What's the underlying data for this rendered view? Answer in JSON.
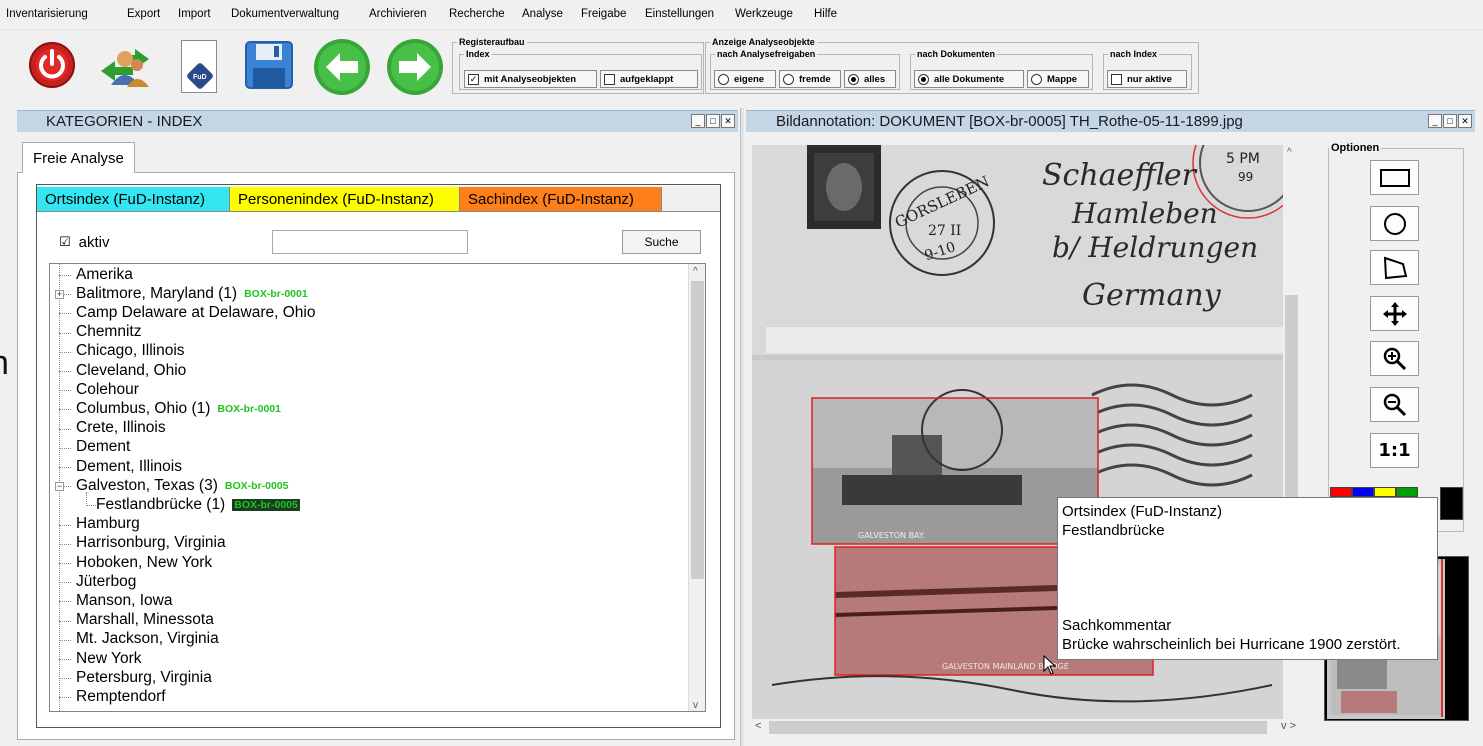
{
  "menu": [
    "Inventarisierung",
    "Export",
    "Import",
    "Dokumentverwaltung",
    "Archivieren",
    "Recherche",
    "Analyse",
    "Freigabe",
    "Einstellungen",
    "Werkzeuge",
    "Hilfe"
  ],
  "toolbar": {
    "fud_label": "FuD",
    "registeraufbau": {
      "title": "Registeraufbau",
      "index_title": "Index",
      "mit_analyseobjekten": "mit Analyseobjekten",
      "aufgeklappt": "aufgeklappt"
    },
    "anzeige": {
      "title": "Anzeige Analyseobjekte",
      "nach_freigaben_title": "nach Analysefreigaben",
      "eigene": "eigene",
      "fremde": "fremde",
      "alles": "alles",
      "nach_dokumenten_title": "nach Dokumenten",
      "alle_dokumente": "alle Dokumente",
      "mappe": "Mappe",
      "nach_index_title": "nach Index",
      "nur_aktive": "nur aktive"
    }
  },
  "left_panel": {
    "title": "KATEGORIEN - INDEX",
    "outer_tab": "Freie Analyse",
    "tabs": [
      {
        "label": "Ortsindex (FuD-Instanz)",
        "color": "#33e6f2"
      },
      {
        "label": "Personenindex (FuD-Instanz)",
        "color": "#fdfd00"
      },
      {
        "label": "Sachindex (FuD-Instanz)",
        "color": "#ff7f1a"
      }
    ],
    "aktiv_label": "aktiv",
    "search_value": "",
    "search_button": "Suche",
    "tree": [
      {
        "label": "Amerika",
        "level": 0
      },
      {
        "label": "Balitmore, Maryland (1)",
        "badge": "BOX-br-0001",
        "level": 0,
        "expander": "+"
      },
      {
        "label": "Camp Delaware at Delaware, Ohio",
        "level": 0
      },
      {
        "label": "Chemnitz",
        "level": 0
      },
      {
        "label": "Chicago, Illinois",
        "level": 0
      },
      {
        "label": "Cleveland, Ohio",
        "level": 0
      },
      {
        "label": "Colehour",
        "level": 0
      },
      {
        "label": "Columbus, Ohio (1)",
        "badge": "BOX-br-0001",
        "level": 0
      },
      {
        "label": "Crete, Illinois",
        "level": 0
      },
      {
        "label": "Dement",
        "level": 0
      },
      {
        "label": "Dement, Illinois",
        "level": 0
      },
      {
        "label": "Galveston, Texas (3)",
        "badge": "BOX-br-0005",
        "level": 0,
        "expander": "−"
      },
      {
        "label": "Festlandbrücke (1)",
        "badge": "BOX-br-0005",
        "level": 1,
        "selected": true
      },
      {
        "label": "Hamburg",
        "level": 0
      },
      {
        "label": "Harrisonburg, Virginia",
        "level": 0
      },
      {
        "label": "Hoboken, New York",
        "level": 0
      },
      {
        "label": "Jüterbog",
        "level": 0
      },
      {
        "label": "Manson, Iowa",
        "level": 0
      },
      {
        "label": "Marshall, Minessota",
        "level": 0
      },
      {
        "label": "Mt. Jackson, Virginia",
        "level": 0
      },
      {
        "label": "New York",
        "level": 0
      },
      {
        "label": "Petersburg, Virginia",
        "level": 0
      },
      {
        "label": "Remptendorf",
        "level": 0
      }
    ]
  },
  "right_panel": {
    "title": "Bildannotation: DOKUMENT [BOX-br-0005] TH_Rothe-05-11-1899.jpg",
    "options_title": "Optionen",
    "zoom_reset_label": "1:1",
    "postcard": {
      "stamp_text": "GORSLEBEN",
      "stamp_date": "27 II",
      "stamp_year": "9-10",
      "time_text": "5 PM",
      "time_day": "99",
      "script_lines": [
        "Schaeffler",
        "Hamleben",
        "b/ Heldrungen",
        "Germany"
      ],
      "caption_bay": "GALVESTON BAY.",
      "caption_bridge": "GALVESTON MAINLAND BRIDGE"
    },
    "tooltip": {
      "line1": "Ortsindex (FuD-Instanz)",
      "line2": "Festlandbrücke",
      "line3": "Sachkommentar",
      "line4": "Brücke wahrscheinlich bei Hurricane 1900 zerstört."
    },
    "palette": [
      "#ff0000",
      "#0000ff",
      "#ffff00",
      "#00a000",
      "#000000"
    ]
  }
}
